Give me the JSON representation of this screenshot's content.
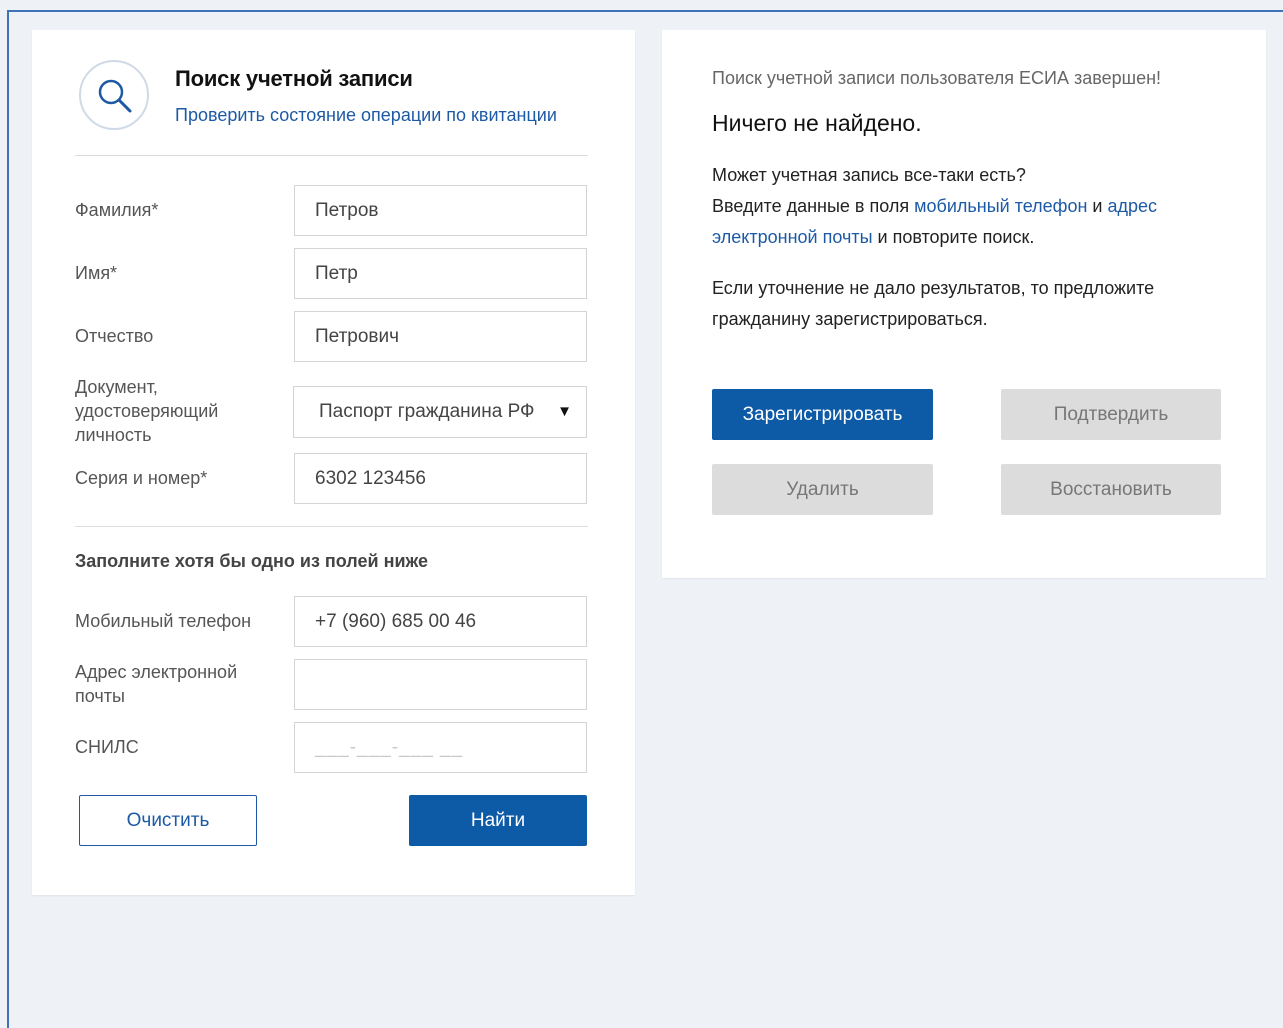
{
  "search_form": {
    "title": "Поиск учетной записи",
    "check_link": "Проверить состояние операции по квитанции",
    "icon": "search-icon",
    "fields": {
      "last_name": {
        "label": "Фамилия*",
        "value": "Петров"
      },
      "first_name": {
        "label": "Имя*",
        "value": "Петр"
      },
      "patronymic": {
        "label": "Отчество",
        "value": "Петрович"
      },
      "document": {
        "label": "Документ, удостоверяющий личность",
        "value": "Паспорт гражданина РФ"
      },
      "series_number": {
        "label": "Серия и номер*",
        "value": "6302 123456"
      }
    },
    "optional_heading": "Заполните хотя бы одно из полей ниже",
    "optional_fields": {
      "mobile": {
        "label": "Мобильный телефон",
        "value": "+7 (960) 685 00 46"
      },
      "email": {
        "label": "Адрес электронной почты",
        "value": ""
      },
      "snils": {
        "label": "СНИЛС",
        "mask": "___-___-___ __"
      }
    },
    "buttons": {
      "clear": "Очистить",
      "find": "Найти"
    }
  },
  "result_panel": {
    "status": "Поиск учетной записи пользователя ЕСИА завершен!",
    "nothing_found": "Ничего не найдено.",
    "hint_line1": "Может учетная запись все-таки есть?",
    "hint_line2_pre": "Введите данные в поля ",
    "hint_link_mobile": "мобильный телефон",
    "hint_and": " и ",
    "hint_link_email": "адрес электронной почты",
    "hint_post": " и повторите поиск.",
    "suggest": "Если уточнение не дало результатов, то предложите гражданину зарегистрироваться.",
    "buttons": {
      "register": "Зарегистрировать",
      "confirm": "Подтвердить",
      "delete": "Удалить",
      "restore": "Восстановить"
    }
  },
  "colors": {
    "primary": "#0d5aa7",
    "link": "#1d5aa5",
    "disabled": "#dcdcdc",
    "background": "#eef2f6"
  }
}
